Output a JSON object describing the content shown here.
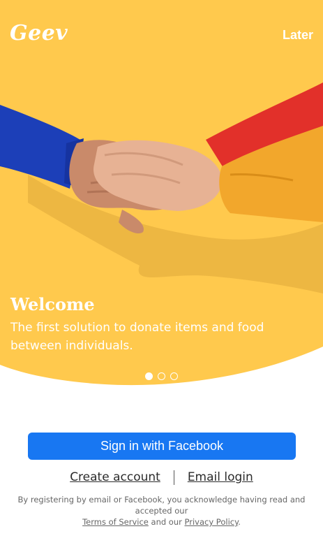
{
  "header": {
    "logo_text": "Geev",
    "later_label": "Later"
  },
  "hero": {
    "background_color": "#ffc94d",
    "title": "Welcome",
    "subtitle": "The first solution to donate items and food between individuals.",
    "carousel": {
      "page_count": 3,
      "active_index": 0
    }
  },
  "actions": {
    "facebook_label": "Sign in with Facebook",
    "facebook_color": "#1877f2",
    "create_account_label": "Create account",
    "email_login_label": "Email login"
  },
  "legal": {
    "prefix": "By registering by email or Facebook, you acknowledge having read and accepted our",
    "terms_label": "Terms of Service",
    "middle": "and our",
    "privacy_label": "Privacy Policy",
    "suffix": "."
  }
}
